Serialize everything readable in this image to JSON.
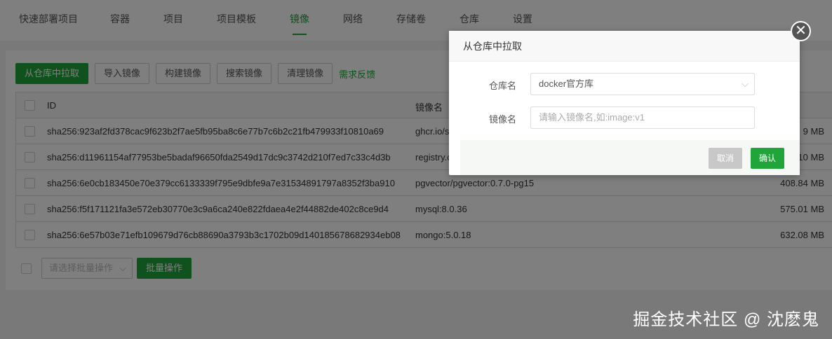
{
  "nav": {
    "tabs": [
      "快速部署项目",
      "容器",
      "项目",
      "项目模板",
      "镜像",
      "网络",
      "存储卷",
      "仓库",
      "设置"
    ],
    "active": 4
  },
  "toolbar": {
    "pull": "从仓库中拉取",
    "import": "导入镜像",
    "build": "构建镜像",
    "search": "搜索镜像",
    "clean": "清理镜像",
    "feedback": "需求反馈"
  },
  "table": {
    "headers": {
      "id": "ID",
      "name": "镜像名"
    },
    "rows": [
      {
        "id": "sha256:923af2fd378cac9f623b2f7ae5fb95ba8c6e77b7c6b2c21fb479933f10810a69",
        "name": "ghcr.io/s",
        "size": "9 MB"
      },
      {
        "id": "sha256:d11961154af77953be5badaf96650fda2549d17dc9c3742d210f7ed7c33c4d3b",
        "name": "registry.c",
        "size": "10 MB"
      },
      {
        "id": "sha256:6e0cb183450e70e379cc6133339f795e9dbfe9a7e31534891797a8352f3ba910",
        "name": "pgvector/pgvector:0.7.0-pg15",
        "size": "408.84 MB"
      },
      {
        "id": "sha256:f5f171121fa3e572eb30770e3c9a6ca240e822fdaea4e2f44882de402c8ce9d4",
        "name": "mysql:8.0.36",
        "size": "575.01 MB"
      },
      {
        "id": "sha256:6e57b03e71efb109679d76cb88690a3793b3c1702b09d140185678682934eb08",
        "name": "mongo:5.0.18",
        "size": "632.08 MB"
      }
    ]
  },
  "batch": {
    "placeholder": "请选择批量操作",
    "button": "批量操作"
  },
  "modal": {
    "title": "从仓库中拉取",
    "repo_label": "仓库名",
    "repo_value": "docker官方库",
    "image_label": "镜像名",
    "image_placeholder": "请输入镜像名,如:image:v1",
    "cancel": "取消",
    "confirm": "确认"
  },
  "watermark": "掘金技术社区 @ 沈麽鬼",
  "colors": {
    "accent": "#20a53a"
  }
}
